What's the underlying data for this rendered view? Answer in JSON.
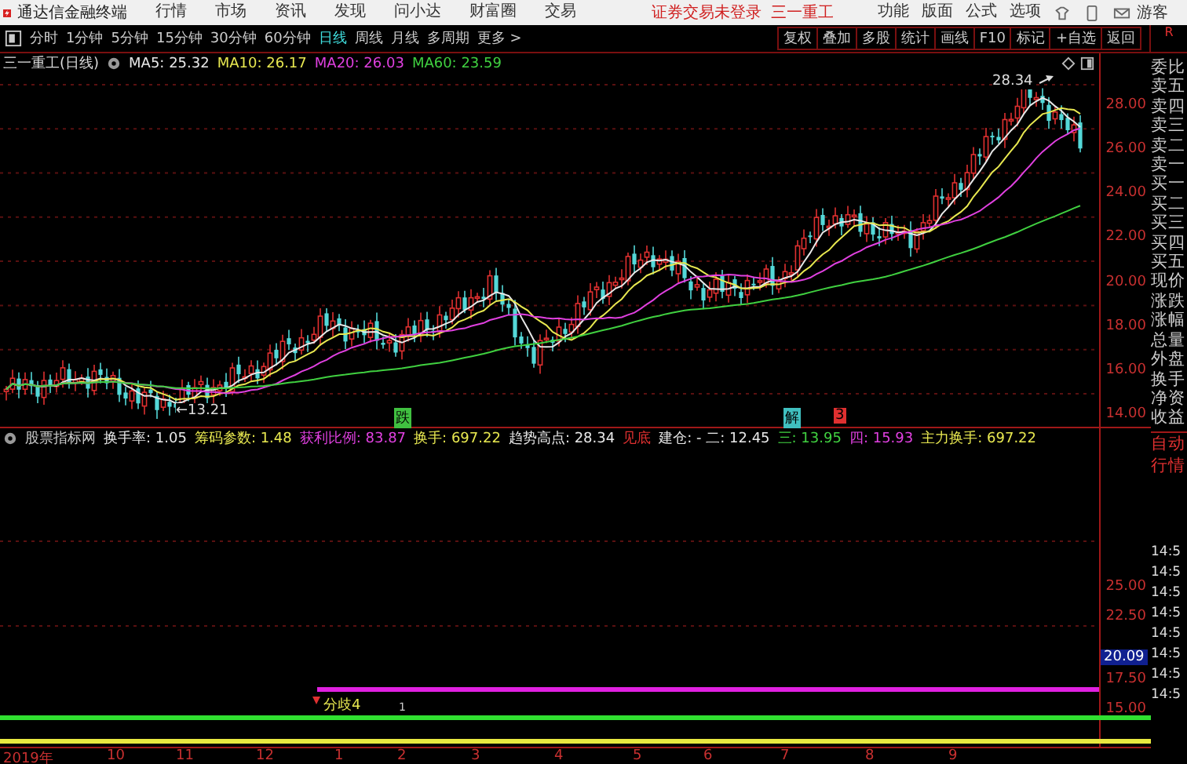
{
  "title_bar": {
    "app_name": "通达信金融终端",
    "menus": [
      "行情",
      "市场",
      "资讯",
      "发现",
      "问小达",
      "财富圈",
      "交易"
    ],
    "login_status": "证券交易未登录",
    "stock_name": "三一重工",
    "tools": [
      "功能",
      "版面",
      "公式",
      "选项"
    ],
    "user": "游客"
  },
  "period_tabs": [
    {
      "label": "分时",
      "selected": false
    },
    {
      "label": "1分钟",
      "selected": false
    },
    {
      "label": "5分钟",
      "selected": false
    },
    {
      "label": "15分钟",
      "selected": false
    },
    {
      "label": "30分钟",
      "selected": false
    },
    {
      "label": "60分钟",
      "selected": false
    },
    {
      "label": "日线",
      "selected": true
    },
    {
      "label": "周线",
      "selected": false
    },
    {
      "label": "月线",
      "selected": false
    },
    {
      "label": "多周期",
      "selected": false
    },
    {
      "label": "更多 >",
      "selected": false
    }
  ],
  "chart_tools": [
    "复权",
    "叠加",
    "多股",
    "统计",
    "画线",
    "F10",
    "标记",
    "+自选",
    "返回"
  ],
  "price_panel": {
    "title": "三一重工(日线)",
    "ma": [
      {
        "text": "MA5: 25.32",
        "color": "#e8e8e8"
      },
      {
        "text": "MA10: 26.17",
        "color": "#e8e850"
      },
      {
        "text": "MA20: 26.03",
        "color": "#e040e0"
      },
      {
        "text": "MA60: 23.59",
        "color": "#40d040"
      }
    ],
    "y_ticks": [
      "28.00",
      "26.00",
      "24.00",
      "22.00",
      "20.00",
      "18.00",
      "16.00",
      "14.00"
    ],
    "high_label": "28.34",
    "low_label": "←13.21",
    "signals": [
      {
        "text": "跌",
        "color": "#40c040"
      },
      {
        "text": "解",
        "color": "#40c0c0"
      },
      {
        "text": "3",
        "color": "#e03030"
      }
    ]
  },
  "quote_panel": {
    "top_label": "R",
    "rows": [
      "委比",
      "卖五",
      "卖四",
      "卖三",
      "卖二",
      "卖一",
      "买一",
      "买二",
      "买三",
      "买四",
      "买五",
      "现价",
      "涨跌",
      "涨幅",
      "总量",
      "外盘",
      "换手",
      "净资",
      "收益"
    ],
    "lower_rows": [
      "自动",
      "行情"
    ],
    "times": [
      "14:5",
      "14:5",
      "14:5",
      "14:5",
      "14:5",
      "14:5",
      "14:5",
      "14:5"
    ]
  },
  "indicator_panel": {
    "name": "股票指标网",
    "values": [
      {
        "text": "换手率: 1.05",
        "color": "#e8e8e8"
      },
      {
        "text": "筹码参数: 1.48",
        "color": "#e8e850"
      },
      {
        "text": "获利比例: 83.87",
        "color": "#e040e0"
      },
      {
        "text": "换手: 697.22",
        "color": "#e8e850"
      },
      {
        "text": "趋势高点: 28.34",
        "color": "#e8e8e8"
      },
      {
        "text": "见底",
        "color": "#e03030"
      },
      {
        "text": "建仓: - 二: 12.45",
        "color": "#e8e8e8"
      },
      {
        "text": "三: 13.95",
        "color": "#40d040"
      },
      {
        "text": "四: 15.93",
        "color": "#e040e0"
      },
      {
        "text": "主力换手: 697.22",
        "color": "#e8e850"
      }
    ],
    "y_ticks": [
      "25.00",
      "22.50",
      "17.50",
      "15.00"
    ],
    "current_value": "20.09",
    "divergence_label": "分歧4",
    "small_label": "1"
  },
  "x_axis": [
    "2019年",
    "10",
    "11",
    "12",
    "1",
    "2",
    "3",
    "4",
    "5",
    "6",
    "7",
    "8",
    "9"
  ]
}
